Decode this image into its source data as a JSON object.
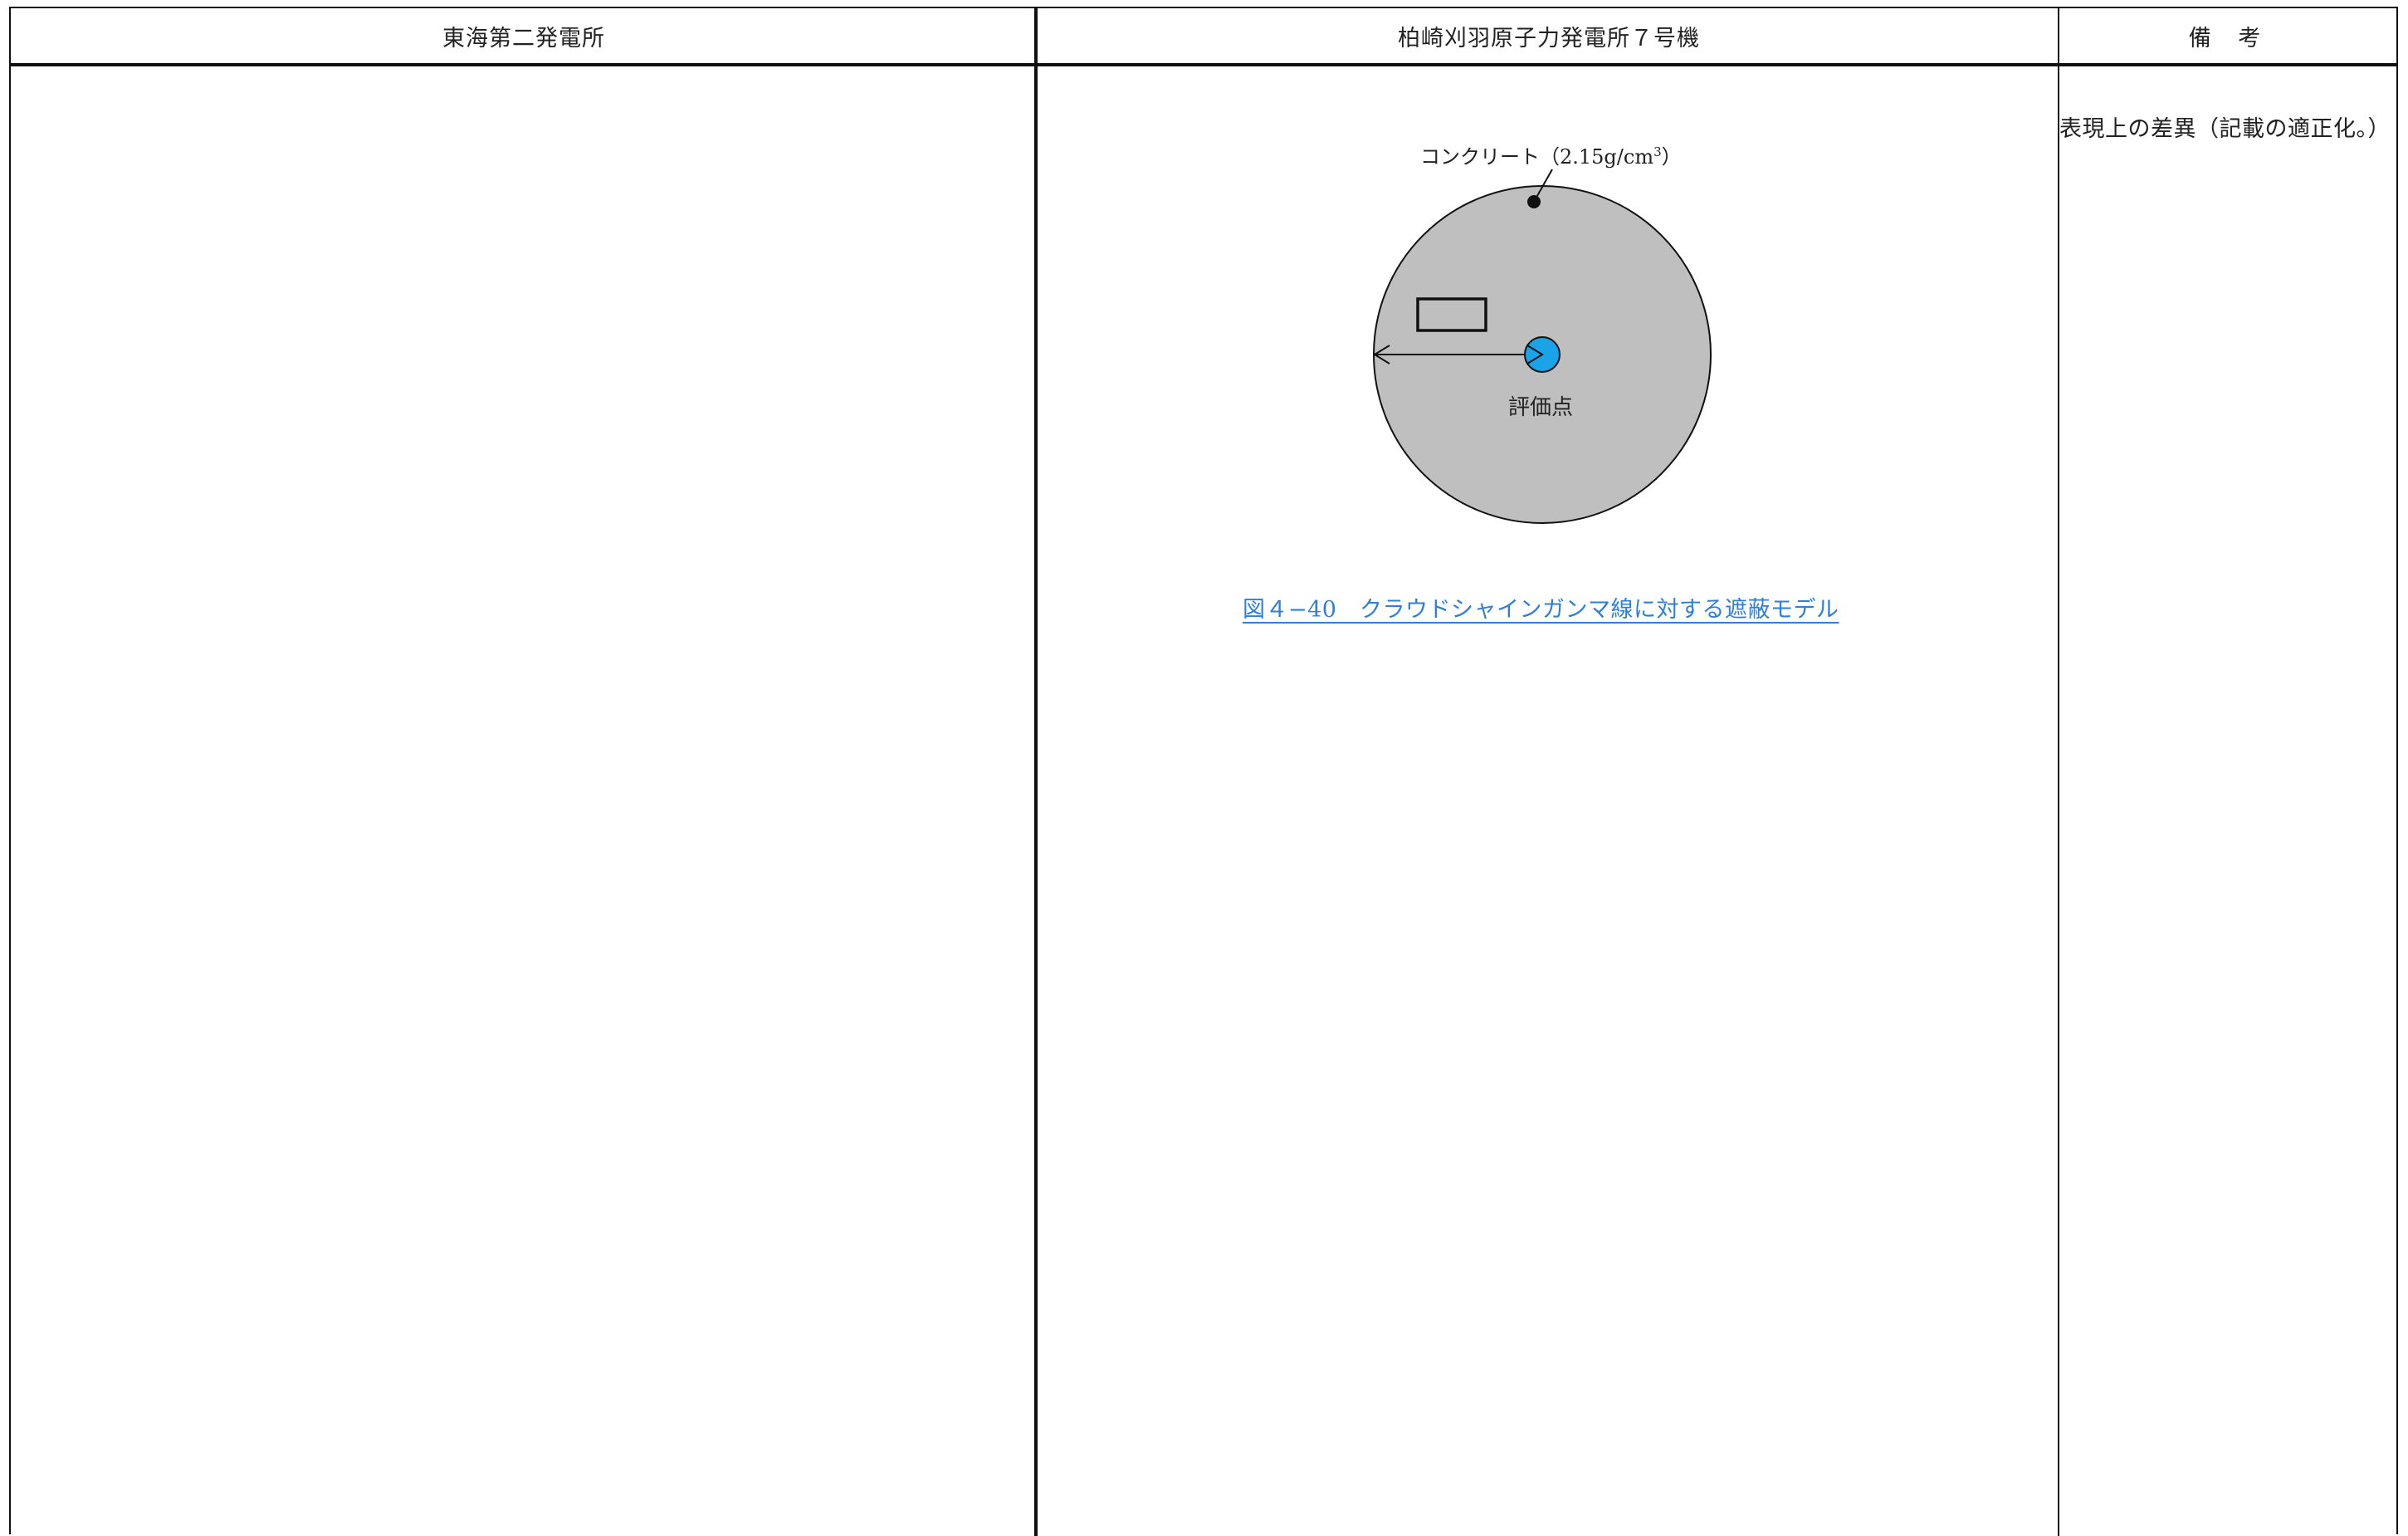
{
  "header": {
    "col1": "東海第二発電所",
    "col2": "柏崎刈羽原子力発電所７号機",
    "col3": "備 考"
  },
  "remarks": {
    "note": "表現上の差異（記載の適正化。）"
  },
  "figure": {
    "material_label": "コンクリート（2.15g/cm",
    "material_label_sup": "3",
    "material_label_close": "）",
    "eval_point_label": "評価点",
    "caption": "図４−40　クラウドシャインガンマ線に対する遮蔽モデル",
    "colors": {
      "concrete_fill": "#bfbfbf",
      "eval_point_fill": "#1aa3e8",
      "caption_color": "#2f7fd4"
    }
  }
}
